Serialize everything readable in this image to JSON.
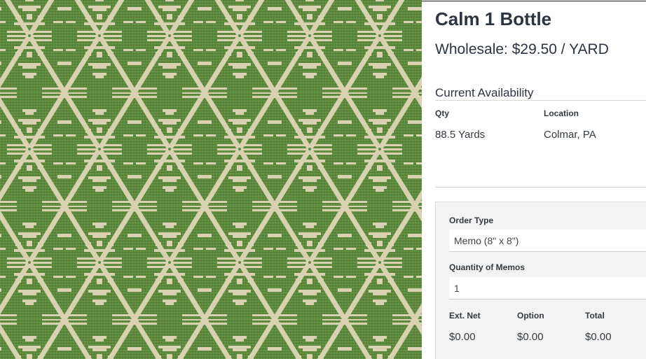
{
  "product": {
    "image_alt": "Green and cream woven ikat-style fabric swatch",
    "title": "Calm 1 Bottle",
    "price_line": "Wholesale: $29.50 / YARD",
    "colors": {
      "fabric_green": "#5e8a3f",
      "fabric_cream": "#d8d2b0"
    }
  },
  "availability": {
    "heading": "Current Availability",
    "columns": [
      "Qty",
      "Location"
    ],
    "rows": [
      {
        "qty": "88.5 Yards",
        "location": "Colmar, PA"
      }
    ]
  },
  "order": {
    "order_type_label": "Order Type",
    "order_type_value": "Memo (8\" x 8\")",
    "quantity_label": "Quantity of Memos",
    "quantity_value": "1",
    "totals": {
      "ext_net_label": "Ext. Net",
      "ext_net_value": "$0.00",
      "option_label": "Option",
      "option_value": "$0.00",
      "total_label": "Total",
      "total_value": "$0.00"
    }
  }
}
